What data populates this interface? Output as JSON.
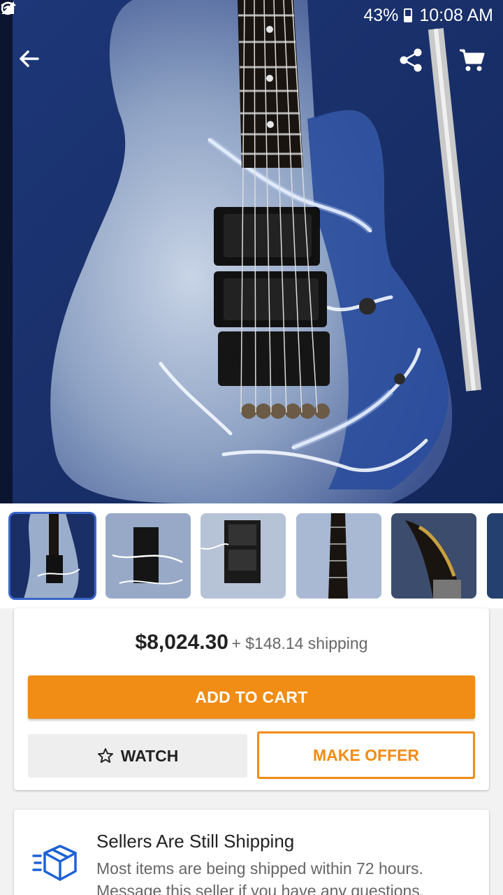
{
  "status_bar": {
    "battery": "43%",
    "time": "10:08 AM",
    "icons": [
      "alarm-icon",
      "wifi-icon",
      "signal-icon",
      "battery-icon"
    ]
  },
  "top_bar": {
    "back_icon": "arrow-left-icon",
    "share_icon": "share-icon",
    "cart_icon": "cart-icon"
  },
  "thumbnails": [
    {
      "name": "thumb-1",
      "selected": true
    },
    {
      "name": "thumb-2",
      "selected": false
    },
    {
      "name": "thumb-3",
      "selected": false
    },
    {
      "name": "thumb-4",
      "selected": false
    },
    {
      "name": "thumb-5",
      "selected": false
    },
    {
      "name": "thumb-6",
      "selected": false
    }
  ],
  "listing": {
    "price": "$8,024.30",
    "shipping": "+ $148.14 shipping",
    "add_to_cart": "ADD TO CART",
    "watch": "WATCH",
    "make_offer": "MAKE OFFER"
  },
  "notice": {
    "title": "Sellers Are Still Shipping",
    "body": "Most items are being shipped within 72 hours. Message this seller if you have any questions."
  },
  "colors": {
    "accent": "#f18c14",
    "selected_outline": "#3a64c8",
    "notice_icon": "#1d62d6"
  }
}
